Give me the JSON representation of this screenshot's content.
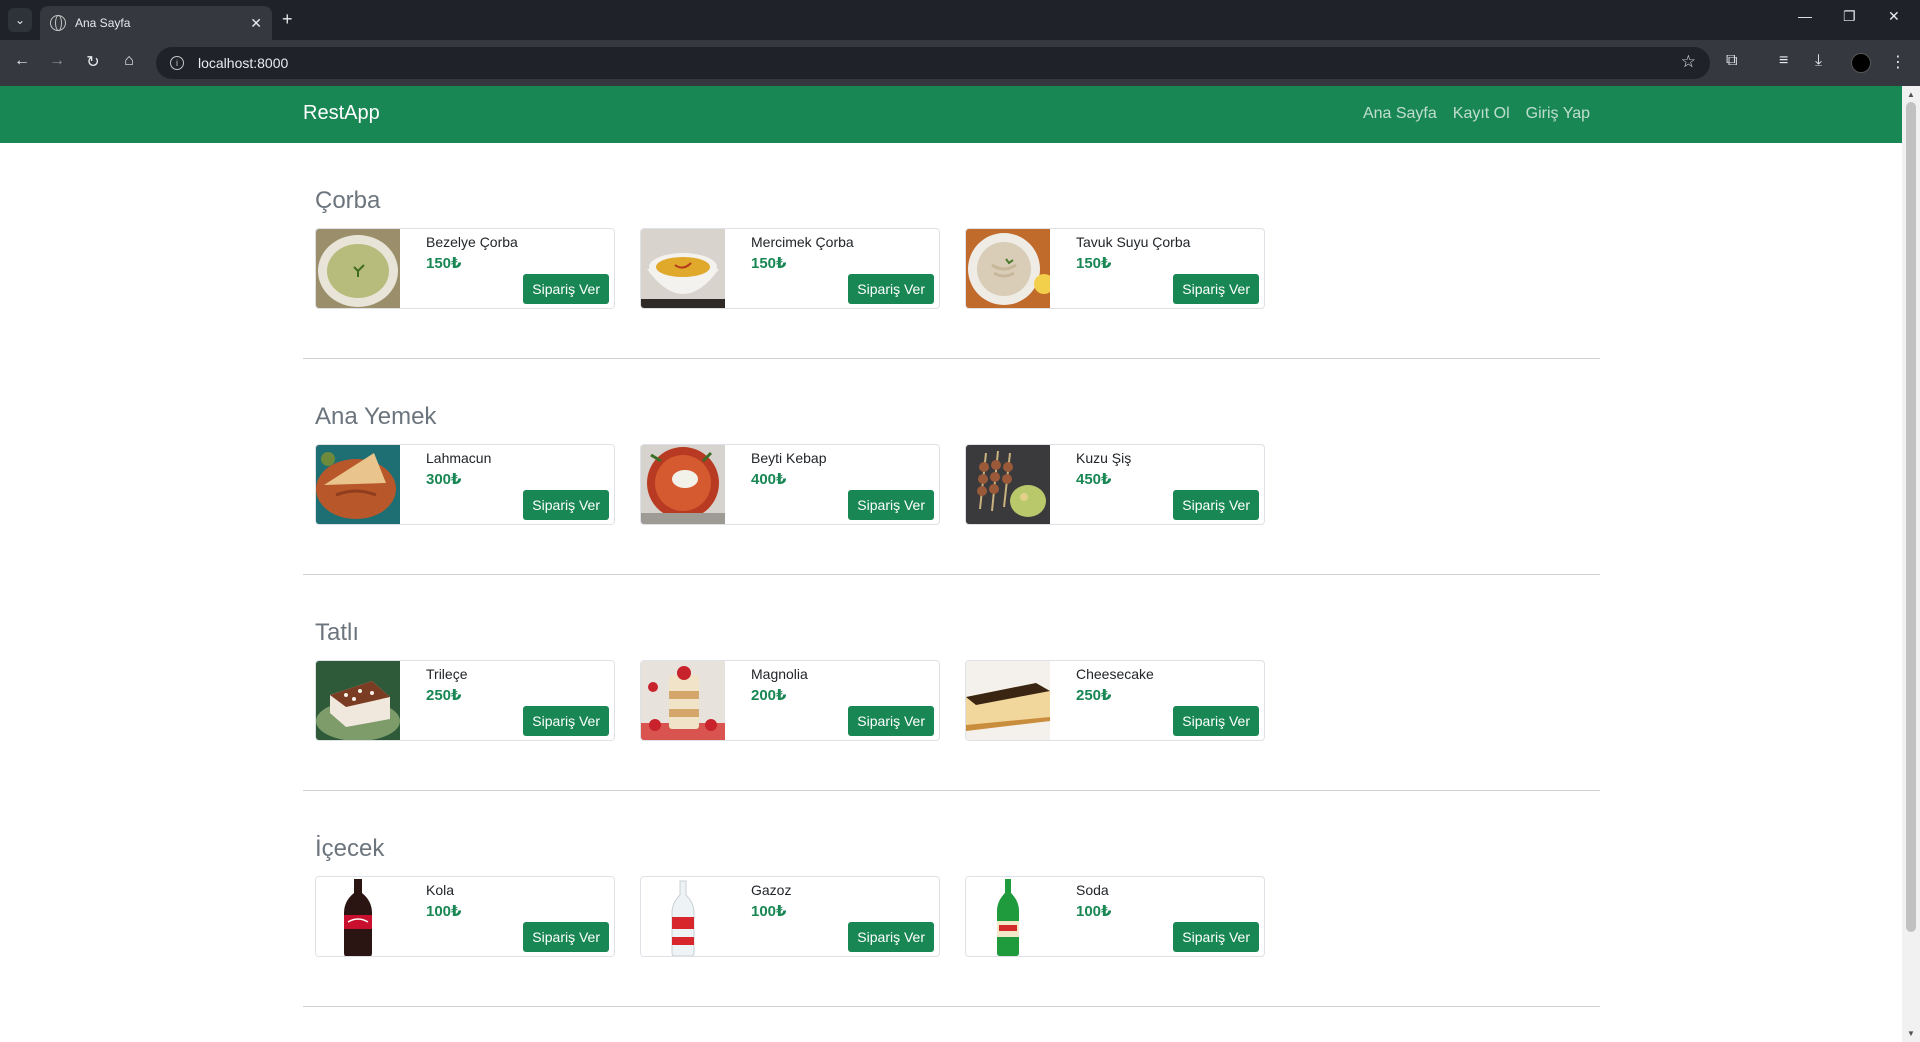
{
  "browser": {
    "tab_title": "Ana Sayfa",
    "url": "localhost:8000"
  },
  "navbar": {
    "brand": "RestApp",
    "links": [
      "Ana Sayfa",
      "Kayıt Ol",
      "Giriş Yap"
    ]
  },
  "order_button_label": "Sipariş Ver",
  "categories": [
    {
      "title": "Çorba",
      "items": [
        {
          "name": "Bezelye Çorba",
          "price": "150₺"
        },
        {
          "name": "Mercimek Çorba",
          "price": "150₺"
        },
        {
          "name": "Tavuk Suyu Çorba",
          "price": "150₺"
        }
      ]
    },
    {
      "title": "Ana Yemek",
      "items": [
        {
          "name": "Lahmacun",
          "price": "300₺"
        },
        {
          "name": "Beyti Kebap",
          "price": "400₺"
        },
        {
          "name": "Kuzu Şiş",
          "price": "450₺"
        }
      ]
    },
    {
      "title": "Tatlı",
      "items": [
        {
          "name": "Trileçe",
          "price": "250₺"
        },
        {
          "name": "Magnolia",
          "price": "200₺"
        },
        {
          "name": "Cheesecake",
          "price": "250₺"
        }
      ]
    },
    {
      "title": "İçecek",
      "items": [
        {
          "name": "Kola",
          "price": "100₺"
        },
        {
          "name": "Gazoz",
          "price": "100₺"
        },
        {
          "name": "Soda",
          "price": "100₺"
        }
      ]
    }
  ],
  "colors": {
    "brand_green": "#198754",
    "chrome_dark": "#1f2329",
    "chrome_toolbar": "#35393f"
  }
}
